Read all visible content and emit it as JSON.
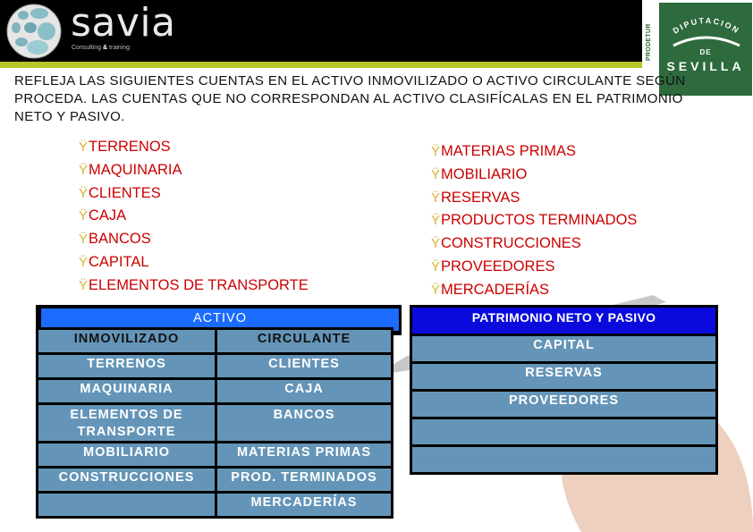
{
  "header": {
    "brand": {
      "name": "savia",
      "tagline_prefix": "Consulting",
      "tagline_amp": "&",
      "tagline_suffix": "training"
    },
    "partner_logo": {
      "side_label": "PRODETUR",
      "line1": "DIPUTACION",
      "line2": "DE",
      "line3": "SEVILLA"
    },
    "colors": {
      "bar": "#000000",
      "stripe": "#b6c626",
      "partner_green": "#2d6a3d"
    }
  },
  "instruction": "REFLEJA LAS SIGUIENTES CUENTAS EN EL ACTIVO INMOVILIZADO O ACTIVO CIRCULANTE SEGÚN PROCEDA. LAS CUENTAS QUE NO CORRESPONDAN AL ACTIVO CLASIFÍCALAS EN EL PATRIMONIO NETO Y PASIVO.",
  "bullet_marker": "Ÿ",
  "accounts_left": [
    "TERRENOS",
    "MAQUINARIA",
    "CLIENTES",
    "CAJA",
    "BANCOS",
    "CAPITAL",
    "ELEMENTOS DE TRANSPORTE"
  ],
  "accounts_right": [
    "MATERIAS PRIMAS",
    "MOBILIARIO",
    "RESERVAS",
    "PRODUCTOS TERMINADOS",
    "CONSTRUCCIONES",
    "PROVEEDORES",
    "MERCADERÍAS"
  ],
  "activo_table": {
    "title": "ACTIVO",
    "columns": [
      "INMOVILIZADO",
      "CIRCULANTE"
    ],
    "rows": [
      [
        "TERRENOS",
        "CLIENTES"
      ],
      [
        "MAQUINARIA",
        "CAJA"
      ],
      [
        "ELEMENTOS DE TRANSPORTE",
        "BANCOS"
      ],
      [
        "MOBILIARIO",
        "MATERIAS PRIMAS"
      ],
      [
        "CONSTRUCCIONES",
        "PROD. TERMINADOS"
      ],
      [
        "",
        "MERCADERÍAS"
      ]
    ]
  },
  "pn_table": {
    "title": "PATRIMONIO NETO Y PASIVO",
    "rows": [
      "CAPITAL",
      "RESERVAS",
      "PROVEEDORES",
      "",
      ""
    ]
  },
  "colors": {
    "bullet_text": "#cc0000",
    "bullet_marker": "#d9b42e",
    "cell_fill": "#6495b8",
    "activo_header": "#1b6bff",
    "pn_header": "#0a0adc"
  }
}
